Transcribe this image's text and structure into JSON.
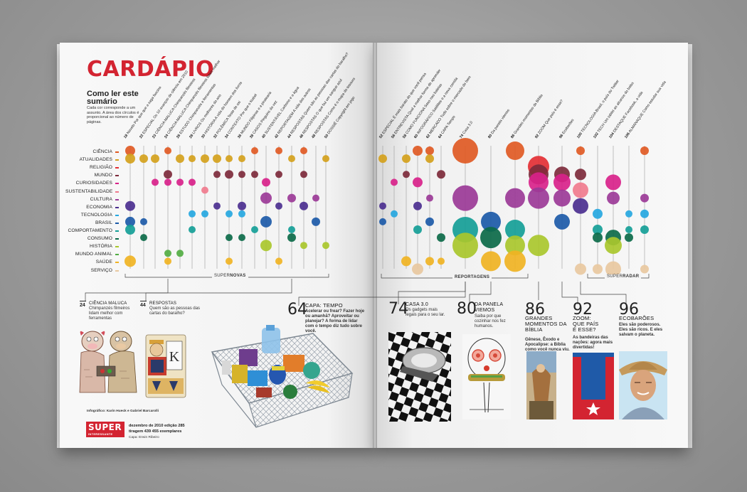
{
  "magazine": {
    "title": "CARDÁPIO",
    "howto_title": "Como ler este sumário",
    "howto_text": "Cada cor corresponde a um assunto. A área dos círculos é proporcional ao número de páginas.",
    "credit": "Infográfico: Karin Hueck e Gabriel Barcarolli",
    "logo_top": "SUPER",
    "logo_bottom": "INTERESSANTE",
    "issue_line1": "dezembro de 2010  edição 285",
    "issue_line2": "tiragem 439 455  exemplares",
    "cover_credit": "Capa: Erwin Ribeiro"
  },
  "categories": [
    {
      "label": "CIÊNCIA",
      "color": "#e05a24"
    },
    {
      "label": "ATUALIDADES",
      "color": "#d4a11c"
    },
    {
      "label": "RELIGIÃO",
      "color": "#e32f34"
    },
    {
      "label": "MUNDO",
      "color": "#7d2a3b"
    },
    {
      "label": "CURIOSIDADES",
      "color": "#d8228a"
    },
    {
      "label": "SUSTENTABILIDADE",
      "color": "#f07b8d"
    },
    {
      "label": "CULTURA",
      "color": "#9b3a97"
    },
    {
      "label": "ECONOMIA",
      "color": "#4b2f8f"
    },
    {
      "label": "TECNOLOGIA",
      "color": "#26a7e0"
    },
    {
      "label": "BRASIL",
      "color": "#1c5aa8"
    },
    {
      "label": "COMPORTAMENTO",
      "color": "#159e97"
    },
    {
      "label": "CONSUMO",
      "color": "#0c6a49"
    },
    {
      "label": "HISTÓRIA",
      "color": "#a9c72c"
    },
    {
      "label": "MUNDO ANIMAL",
      "color": "#52ad43"
    },
    {
      "label": "SAÚDE",
      "color": "#f0b323"
    },
    {
      "label": "SERVIÇO",
      "color": "#e8c8a0"
    }
  ],
  "sections": {
    "supernovas_pre": "SUPER",
    "supernovas_bold": "NOVAS",
    "reportagens": "REPORTAGENS",
    "superradar_pre": "SUPER",
    "superradar_bold": "RADAR"
  },
  "left_columns": [
    {
      "num": "18",
      "text": "Novelo Por que que a saga fascina"
    },
    {
      "num": "22",
      "text": "ESPECIAL Os 10 avanços da ciência em 2010"
    },
    {
      "num": "23",
      "text": "CIÊNCIA MALUCA Chimpanzés filmeiros"
    },
    {
      "num": "24",
      "text": "CIÊNCIA MALUCA Chimpanzés filmeiros lidam melhor"
    },
    {
      "num": "26",
      "text": "ESTUDO Chimpanzés e ferramentas"
    },
    {
      "num": "28",
      "text": "LIVROS Os melhores do ano"
    },
    {
      "num": "30",
      "text": "HISTÓRIA A vida do homem dos livros"
    },
    {
      "num": "32",
      "text": "POLÊMICA Teste de oxi"
    },
    {
      "num": "34",
      "text": "CONTEXTO Por que o Nobel"
    },
    {
      "num": "36",
      "text": "MUNDO Filipinas e a piratearia"
    },
    {
      "num": "38",
      "text": "CASOS Pinguins da vez"
    },
    {
      "num": "40",
      "text": "SUSTENTÁVEL Carbono e a água"
    },
    {
      "num": "42",
      "text": "REPORTAGEM A vida dos outros"
    },
    {
      "num": "44",
      "text": "RESPOSTAS Quem são as pessoas das cartas do baralho?"
    },
    {
      "num": "46",
      "text": "RESPOSTAS O que faz um sangue azul"
    },
    {
      "num": "48",
      "text": "RESPOSTAS Como é o mapa do tesouro"
    },
    {
      "num": "50",
      "text": "DOSSIÊ Copyright em jogo"
    }
  ],
  "right_columns": [
    {
      "num": "52",
      "text": "ESPECIAL É mais barato do que você pensa"
    },
    {
      "num": "56",
      "text": "ENTREVISTA Qual a melhor forma de aprender"
    },
    {
      "num": "58",
      "text": "COMO FUNCIONA Sexo nas baleias"
    },
    {
      "num": "60",
      "text": "INFOGRÁFICO Satélites e a nova corrida"
    },
    {
      "num": "62",
      "text": "MERCADO Tudo sobre o mercado do bem"
    },
    {
      "num": "64",
      "text": "CAPA Tempo"
    },
    {
      "num": "74",
      "text": "Casa 3.0"
    },
    {
      "num": "80",
      "text": "Da panela viemos"
    },
    {
      "num": "86",
      "text": "Grandes momentos da Bíblia"
    },
    {
      "num": "92",
      "text": "ZOOM Que país é esse?"
    },
    {
      "num": "96",
      "text": "Ecobarões"
    },
    {
      "num": "100",
      "text": "TECNOLOGIA Brasil, o país do Twitter"
    },
    {
      "num": "102",
      "text": "TECH Um tablet ao alcance do bolso"
    },
    {
      "num": "104",
      "text": "DESTAQUE Facebook, a vida"
    },
    {
      "num": "106",
      "text": "ALMANAQUE Como estudar sua vida"
    }
  ],
  "features_left": [
    {
      "num": "24",
      "title": "CIÊNCIA MALUCA",
      "text": "Chimpanzés filmeiros lidam melhor com ferramentas"
    },
    {
      "num": "44",
      "title": "RESPOSTAS",
      "text": "Quem são as pessoas das cartas do baralho?"
    }
  ],
  "feature_capa": {
    "num": "64",
    "title": "CAPA: TEMPO",
    "text": "Acelerar ou frear? Fazer hoje ou amanhã? Aproveitar ou planejar? A forma de lidar com o tempo diz tudo sobre você."
  },
  "features_right": [
    {
      "num": "74",
      "title": "CASA 3.0",
      "text": "Os gadgets mais legais para o seu lar."
    },
    {
      "num": "80",
      "title": "DA PANELA VIEMOS",
      "text": "Saiba por que cozinhar nos fez humanos."
    },
    {
      "num": "86",
      "title": "GRANDES MOMENTOS DA BÍBLIA",
      "text": "Gênese, Êxodo e Apocalipse: a Bíblia como você nunca viu."
    },
    {
      "num": "92",
      "title": "ZOOM: QUE PAÍS É ESSE?",
      "text": "As bandeiras das nações: agora mais divertidas!"
    },
    {
      "num": "96",
      "title": "ECOBARÕES",
      "text": "Eles são poderosos. Eles são ricos. E eles salvam o planeta."
    }
  ]
}
